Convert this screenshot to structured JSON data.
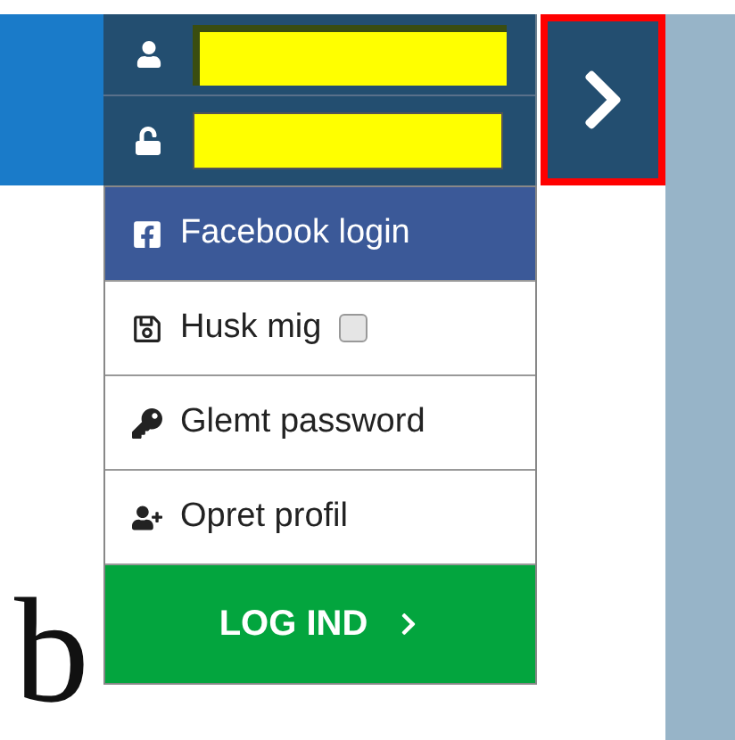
{
  "arrow_button": {
    "focused": true
  },
  "menu": [
    {
      "kind": "facebook",
      "label": "Facebook login"
    },
    {
      "kind": "remember",
      "label": "Husk mig",
      "checked": false
    },
    {
      "kind": "forgot",
      "label": "Glemt password"
    },
    {
      "kind": "signup",
      "label": "Opret profil"
    }
  ],
  "submit": {
    "label": "LOG IND"
  },
  "logo": {
    "text": "b"
  }
}
